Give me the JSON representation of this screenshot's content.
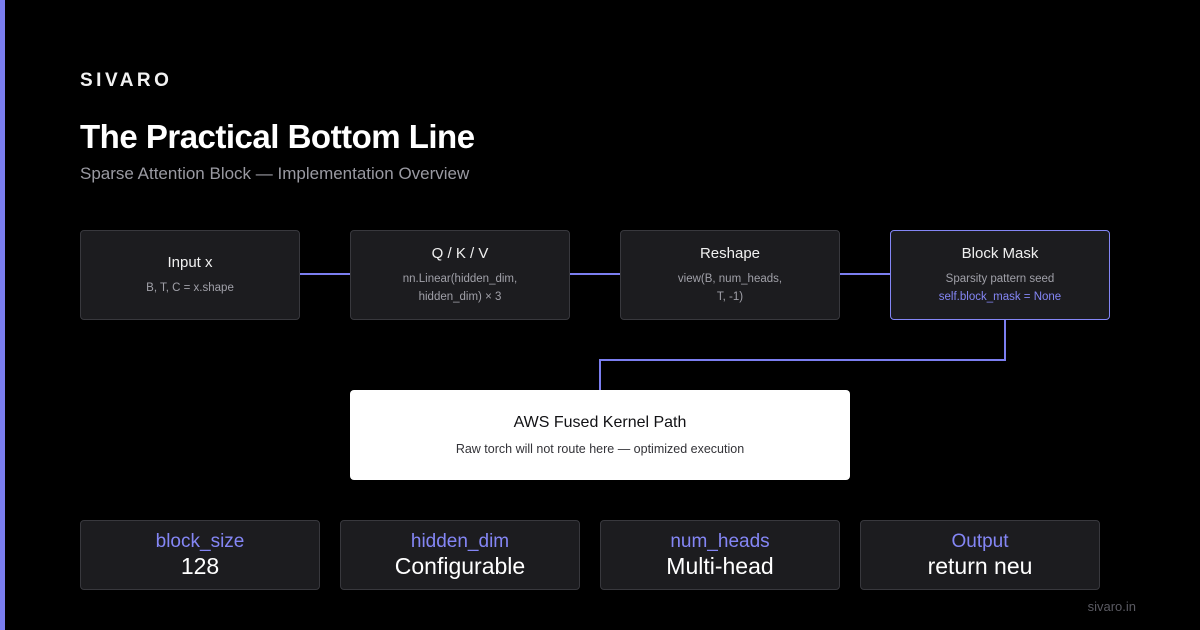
{
  "brand": "SIVARO",
  "title": "The Practical Bottom Line",
  "subtitle": "Sparse Attention Block — Implementation Overview",
  "nodes": [
    {
      "title": "Input x",
      "detail": "B, T, C = x.shape",
      "extra": ""
    },
    {
      "title": "Q / K / V",
      "detail": "nn.Linear(hidden_dim,\nhidden_dim) × 3",
      "extra": ""
    },
    {
      "title": "Reshape",
      "detail": "view(B, num_heads,\nT, -1)",
      "extra": ""
    },
    {
      "title": "Block Mask",
      "detail": "Sparsity pattern seed",
      "extra": "self.block_mask = None"
    }
  ],
  "kernel": {
    "title": "AWS Fused Kernel Path",
    "subtitle": "Raw torch will not route here — optimized execution"
  },
  "stats": [
    {
      "label": "block_size",
      "value": "128"
    },
    {
      "label": "hidden_dim",
      "value": "Configurable"
    },
    {
      "label": "num_heads",
      "value": "Multi-head"
    },
    {
      "label": "Output",
      "value": "return neu"
    }
  ],
  "footer": "sivaro.in",
  "colors": {
    "accent": "#8486f5",
    "background": "#000000",
    "card": "#1c1c1f",
    "kernel_card": "#ffffff"
  }
}
